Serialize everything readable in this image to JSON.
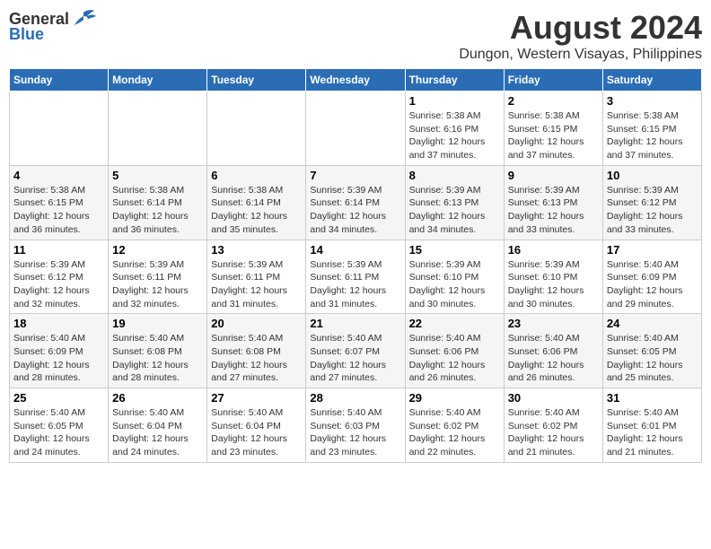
{
  "header": {
    "logo_general": "General",
    "logo_blue": "Blue",
    "month_year": "August 2024",
    "location": "Dungon, Western Visayas, Philippines"
  },
  "days_of_week": [
    "Sunday",
    "Monday",
    "Tuesday",
    "Wednesday",
    "Thursday",
    "Friday",
    "Saturday"
  ],
  "weeks": [
    [
      {
        "day": "",
        "info": ""
      },
      {
        "day": "",
        "info": ""
      },
      {
        "day": "",
        "info": ""
      },
      {
        "day": "",
        "info": ""
      },
      {
        "day": "1",
        "info": "Sunrise: 5:38 AM\nSunset: 6:16 PM\nDaylight: 12 hours\nand 37 minutes."
      },
      {
        "day": "2",
        "info": "Sunrise: 5:38 AM\nSunset: 6:15 PM\nDaylight: 12 hours\nand 37 minutes."
      },
      {
        "day": "3",
        "info": "Sunrise: 5:38 AM\nSunset: 6:15 PM\nDaylight: 12 hours\nand 37 minutes."
      }
    ],
    [
      {
        "day": "4",
        "info": "Sunrise: 5:38 AM\nSunset: 6:15 PM\nDaylight: 12 hours\nand 36 minutes."
      },
      {
        "day": "5",
        "info": "Sunrise: 5:38 AM\nSunset: 6:14 PM\nDaylight: 12 hours\nand 36 minutes."
      },
      {
        "day": "6",
        "info": "Sunrise: 5:38 AM\nSunset: 6:14 PM\nDaylight: 12 hours\nand 35 minutes."
      },
      {
        "day": "7",
        "info": "Sunrise: 5:39 AM\nSunset: 6:14 PM\nDaylight: 12 hours\nand 34 minutes."
      },
      {
        "day": "8",
        "info": "Sunrise: 5:39 AM\nSunset: 6:13 PM\nDaylight: 12 hours\nand 34 minutes."
      },
      {
        "day": "9",
        "info": "Sunrise: 5:39 AM\nSunset: 6:13 PM\nDaylight: 12 hours\nand 33 minutes."
      },
      {
        "day": "10",
        "info": "Sunrise: 5:39 AM\nSunset: 6:12 PM\nDaylight: 12 hours\nand 33 minutes."
      }
    ],
    [
      {
        "day": "11",
        "info": "Sunrise: 5:39 AM\nSunset: 6:12 PM\nDaylight: 12 hours\nand 32 minutes."
      },
      {
        "day": "12",
        "info": "Sunrise: 5:39 AM\nSunset: 6:11 PM\nDaylight: 12 hours\nand 32 minutes."
      },
      {
        "day": "13",
        "info": "Sunrise: 5:39 AM\nSunset: 6:11 PM\nDaylight: 12 hours\nand 31 minutes."
      },
      {
        "day": "14",
        "info": "Sunrise: 5:39 AM\nSunset: 6:11 PM\nDaylight: 12 hours\nand 31 minutes."
      },
      {
        "day": "15",
        "info": "Sunrise: 5:39 AM\nSunset: 6:10 PM\nDaylight: 12 hours\nand 30 minutes."
      },
      {
        "day": "16",
        "info": "Sunrise: 5:39 AM\nSunset: 6:10 PM\nDaylight: 12 hours\nand 30 minutes."
      },
      {
        "day": "17",
        "info": "Sunrise: 5:40 AM\nSunset: 6:09 PM\nDaylight: 12 hours\nand 29 minutes."
      }
    ],
    [
      {
        "day": "18",
        "info": "Sunrise: 5:40 AM\nSunset: 6:09 PM\nDaylight: 12 hours\nand 28 minutes."
      },
      {
        "day": "19",
        "info": "Sunrise: 5:40 AM\nSunset: 6:08 PM\nDaylight: 12 hours\nand 28 minutes."
      },
      {
        "day": "20",
        "info": "Sunrise: 5:40 AM\nSunset: 6:08 PM\nDaylight: 12 hours\nand 27 minutes."
      },
      {
        "day": "21",
        "info": "Sunrise: 5:40 AM\nSunset: 6:07 PM\nDaylight: 12 hours\nand 27 minutes."
      },
      {
        "day": "22",
        "info": "Sunrise: 5:40 AM\nSunset: 6:06 PM\nDaylight: 12 hours\nand 26 minutes."
      },
      {
        "day": "23",
        "info": "Sunrise: 5:40 AM\nSunset: 6:06 PM\nDaylight: 12 hours\nand 26 minutes."
      },
      {
        "day": "24",
        "info": "Sunrise: 5:40 AM\nSunset: 6:05 PM\nDaylight: 12 hours\nand 25 minutes."
      }
    ],
    [
      {
        "day": "25",
        "info": "Sunrise: 5:40 AM\nSunset: 6:05 PM\nDaylight: 12 hours\nand 24 minutes."
      },
      {
        "day": "26",
        "info": "Sunrise: 5:40 AM\nSunset: 6:04 PM\nDaylight: 12 hours\nand 24 minutes."
      },
      {
        "day": "27",
        "info": "Sunrise: 5:40 AM\nSunset: 6:04 PM\nDaylight: 12 hours\nand 23 minutes."
      },
      {
        "day": "28",
        "info": "Sunrise: 5:40 AM\nSunset: 6:03 PM\nDaylight: 12 hours\nand 23 minutes."
      },
      {
        "day": "29",
        "info": "Sunrise: 5:40 AM\nSunset: 6:02 PM\nDaylight: 12 hours\nand 22 minutes."
      },
      {
        "day": "30",
        "info": "Sunrise: 5:40 AM\nSunset: 6:02 PM\nDaylight: 12 hours\nand 21 minutes."
      },
      {
        "day": "31",
        "info": "Sunrise: 5:40 AM\nSunset: 6:01 PM\nDaylight: 12 hours\nand 21 minutes."
      }
    ]
  ]
}
